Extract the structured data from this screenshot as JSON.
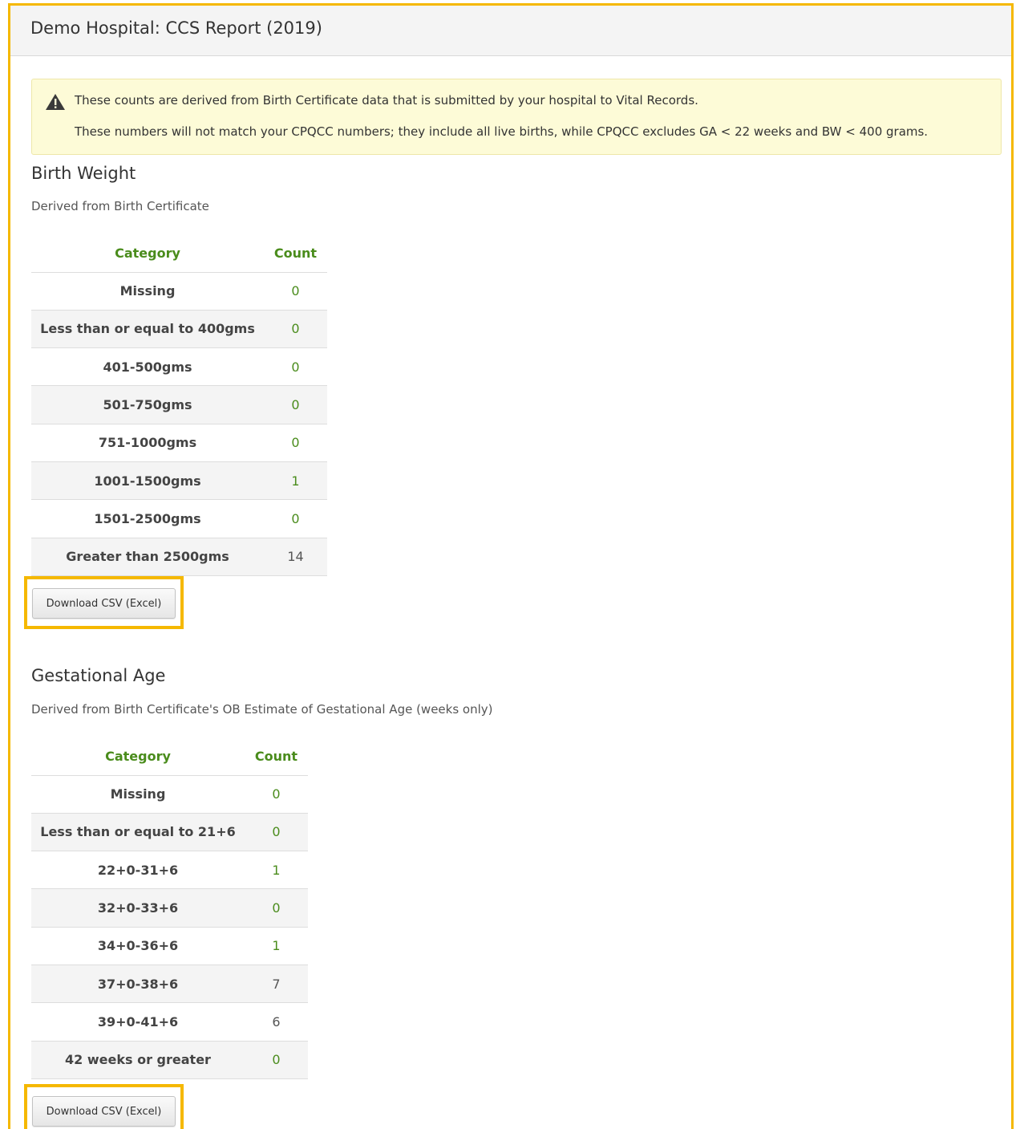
{
  "header": {
    "title": "Demo Hospital:  CCS Report (2019)"
  },
  "alert": {
    "icon": "warning-icon",
    "line1": "These counts are derived from Birth Certificate data that is submitted by your hospital to Vital Records.",
    "line2": "These numbers will not match your CPQCC numbers; they include all live births, while CPQCC excludes GA < 22 weeks and BW < 400 grams."
  },
  "birth_weight": {
    "title": "Birth Weight",
    "subtitle": "Derived from Birth Certificate",
    "columns": [
      "Category",
      "Count"
    ],
    "rows": [
      {
        "category": "Missing",
        "count": "0"
      },
      {
        "category": "Less than or equal to 400gms",
        "count": "0"
      },
      {
        "category": "401-500gms",
        "count": "0"
      },
      {
        "category": "501-750gms",
        "count": "0"
      },
      {
        "category": "751-1000gms",
        "count": "0"
      },
      {
        "category": "1001-1500gms",
        "count": "1"
      },
      {
        "category": "1501-2500gms",
        "count": "0"
      },
      {
        "category": "Greater than 2500gms",
        "count": "14"
      }
    ],
    "download_label": "Download CSV (Excel)"
  },
  "gestational_age": {
    "title": "Gestational Age",
    "subtitle": "Derived from Birth Certificate's OB Estimate of Gestational Age (weeks only)",
    "columns": [
      "Category",
      "Count"
    ],
    "rows": [
      {
        "category": "Missing",
        "count": "0"
      },
      {
        "category": "Less than or equal to 21+6",
        "count": "0"
      },
      {
        "category": "22+0-31+6",
        "count": "1"
      },
      {
        "category": "32+0-33+6",
        "count": "0"
      },
      {
        "category": "34+0-36+6",
        "count": "1"
      },
      {
        "category": "37+0-38+6",
        "count": "7"
      },
      {
        "category": "39+0-41+6",
        "count": "6"
      },
      {
        "category": "42 weeks or greater",
        "count": "0"
      }
    ],
    "download_label": "Download CSV (Excel)"
  },
  "colors": {
    "highlight": "#f5b800",
    "accent_green": "#4a8c1c",
    "alert_bg": "#fdfbd7"
  }
}
